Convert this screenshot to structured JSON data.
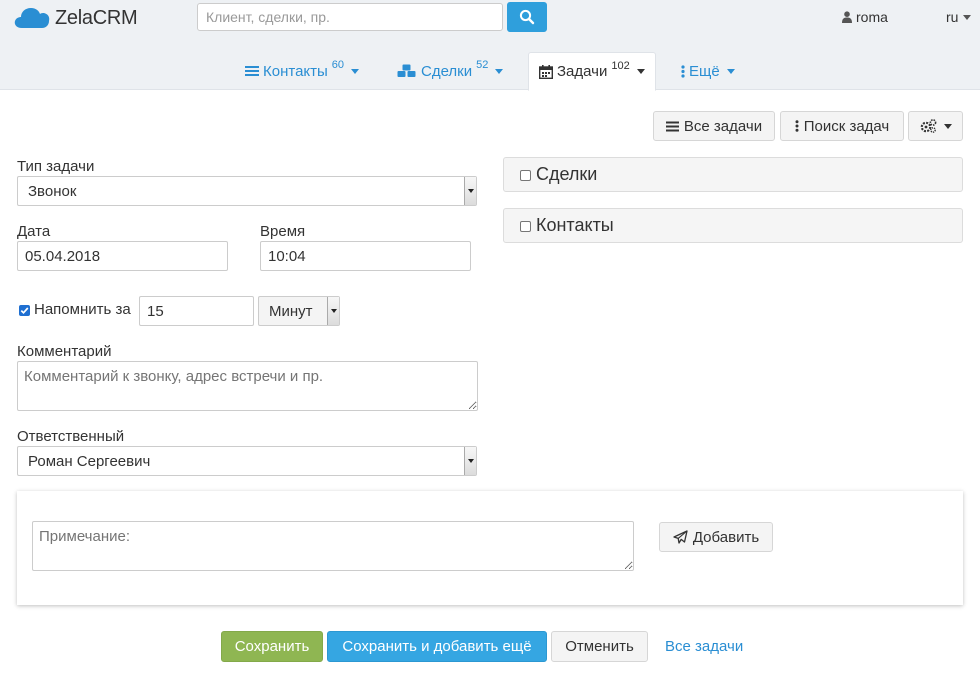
{
  "app": {
    "logo_text": "ZelaCRM"
  },
  "search": {
    "placeholder": "Клиент, сделки, пр."
  },
  "user": {
    "name": "roma",
    "language": "ru"
  },
  "tabs": [
    {
      "label": "Контакты",
      "count": "60",
      "icon": "list-icon"
    },
    {
      "label": "Сделки",
      "count": "52",
      "icon": "cubes-icon"
    },
    {
      "label": "Задачи",
      "count": "102",
      "icon": "calendar-icon"
    },
    {
      "label": "Ещё",
      "count": "",
      "icon": "vertical-ellipsis-icon"
    }
  ],
  "toolbar": {
    "all_tasks_label": "Все задачи",
    "search_tasks_label": "Поиск задач",
    "settings_icon": "cogs-icon"
  },
  "form": {
    "task_type": {
      "label": "Тип задачи",
      "value": "Звонок"
    },
    "date": {
      "label": "Дата",
      "value": "05.04.2018"
    },
    "time": {
      "label": "Время",
      "value": "10:04"
    },
    "remind": {
      "label": "Напомнить за",
      "checked": true,
      "value": "15",
      "unit": "Минут"
    },
    "comment": {
      "label": "Комментарий",
      "placeholder": "Комментарий к звонку, адрес встречи и пр."
    },
    "responsible": {
      "label": "Ответственный",
      "value": "Роман Сергеевич"
    }
  },
  "panels": {
    "deals_label": "Сделки",
    "contacts_label": "Контакты"
  },
  "note": {
    "placeholder": "Примечание:",
    "add_label": "Добавить"
  },
  "footer": {
    "save_label": "Сохранить",
    "save_add_label": "Сохранить и добавить ещё",
    "cancel_label": "Отменить",
    "all_tasks_link": "Все задачи"
  },
  "colors": {
    "accent": "#2f9fdc",
    "link": "#2a8ed3",
    "save": "#8fb652",
    "header_bg": "#eef1f4"
  }
}
